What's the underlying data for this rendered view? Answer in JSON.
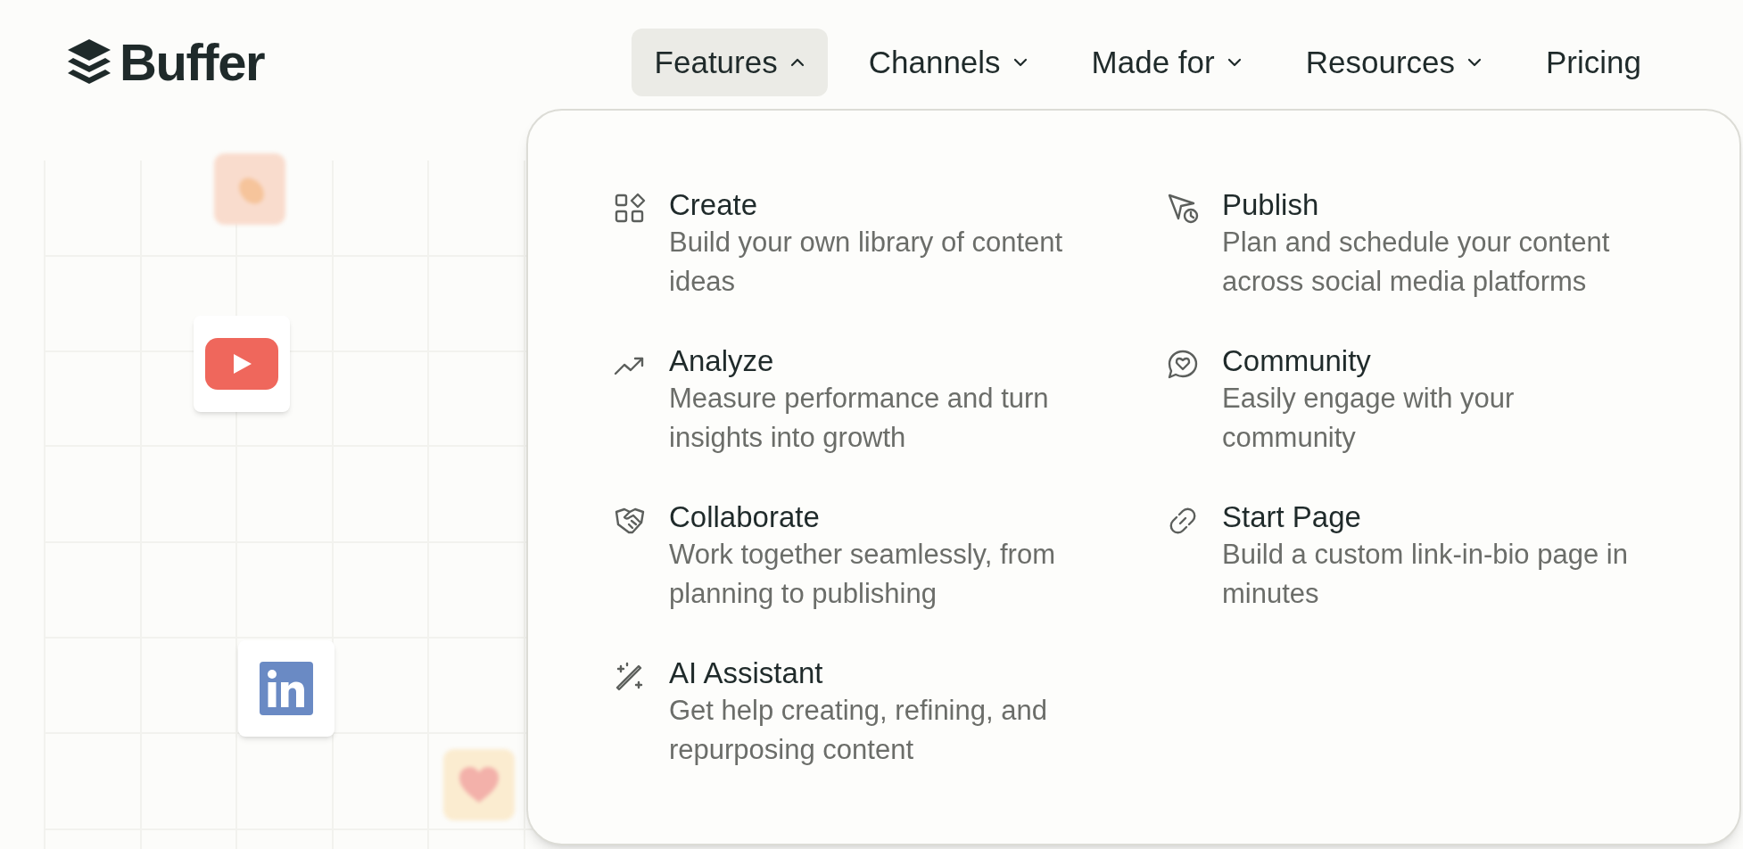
{
  "logo": {
    "text": "Buffer"
  },
  "nav": [
    {
      "label": "Features",
      "kind": "menu",
      "expanded": true
    },
    {
      "label": "Channels",
      "kind": "menu",
      "expanded": false
    },
    {
      "label": "Made for",
      "kind": "menu",
      "expanded": false
    },
    {
      "label": "Resources",
      "kind": "menu",
      "expanded": false
    },
    {
      "label": "Pricing",
      "kind": "link",
      "expanded": false
    }
  ],
  "features_menu": {
    "items": [
      {
        "title": "Create",
        "description": "Build your own library of content ideas"
      },
      {
        "title": "Publish",
        "description": "Plan and schedule your content across social media platforms"
      },
      {
        "title": "Analyze",
        "description": "Measure performance and turn insights into growth"
      },
      {
        "title": "Community",
        "description": "Easily engage with your community"
      },
      {
        "title": "Collaborate",
        "description": "Work together seamlessly, from planning to publishing"
      },
      {
        "title": "Start Page",
        "description": "Build a custom link-in-bio page in minutes"
      },
      {
        "title": "AI Assistant",
        "description": "Get help creating, refining, and repurposing content"
      }
    ]
  }
}
